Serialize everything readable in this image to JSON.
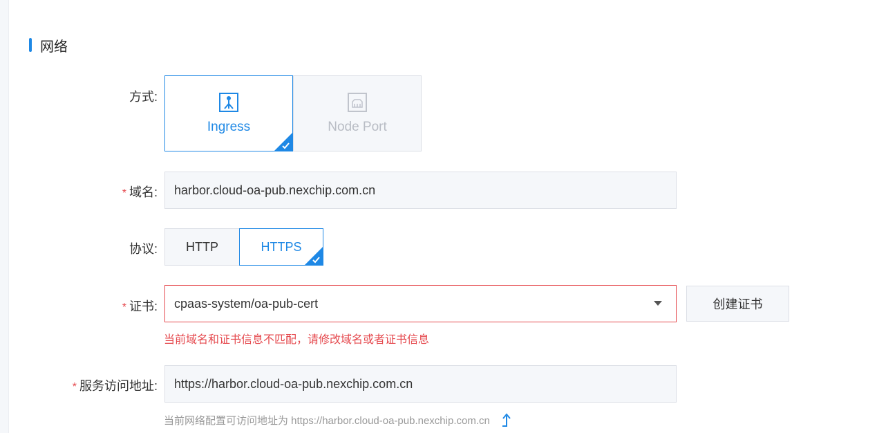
{
  "section": {
    "title": "网络"
  },
  "mode": {
    "label": "方式:",
    "options": [
      {
        "label": "Ingress",
        "icon": "ingress-icon",
        "selected": true
      },
      {
        "label": "Node Port",
        "icon": "node-port-icon",
        "selected": false
      }
    ]
  },
  "domain": {
    "required_mark": "*",
    "label": "域名:",
    "value": "harbor.cloud-oa-pub.nexchip.com.cn"
  },
  "protocol": {
    "label": "协议:",
    "options": [
      {
        "label": "HTTP",
        "selected": false
      },
      {
        "label": "HTTPS",
        "selected": true
      }
    ]
  },
  "certificate": {
    "required_mark": "*",
    "label": "证书:",
    "value": "cpaas-system/oa-pub-cert",
    "create_button": "创建证书",
    "error": "当前域名和证书信息不匹配，请修改域名或者证书信息"
  },
  "service_address": {
    "required_mark": "*",
    "label": "服务访问地址:",
    "value": "https://harbor.cloud-oa-pub.nexchip.com.cn",
    "hint": "当前网络配置可访问地址为 https://harbor.cloud-oa-pub.nexchip.com.cn",
    "hint_icon": "jump-arrow-icon"
  },
  "colors": {
    "accent": "#1e88e5",
    "error": "#e5484d",
    "disabled": "#b8bcc4"
  }
}
